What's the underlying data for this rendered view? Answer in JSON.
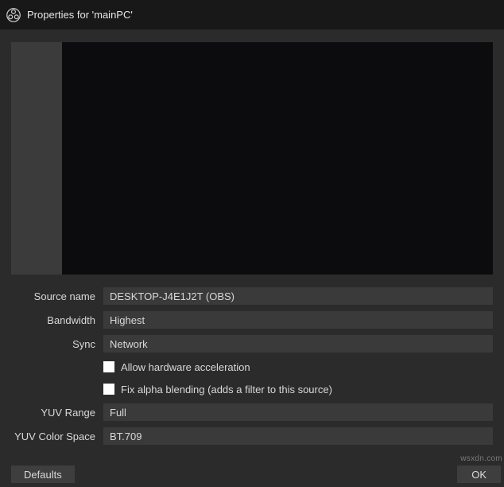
{
  "window": {
    "title": "Properties for 'mainPC'"
  },
  "form": {
    "source_name": {
      "label": "Source name",
      "value": "DESKTOP-J4E1J2T (OBS)"
    },
    "bandwidth": {
      "label": "Bandwidth",
      "value": "Highest"
    },
    "sync": {
      "label": "Sync",
      "value": "Network"
    },
    "hw_accel": {
      "label": "Allow hardware acceleration",
      "checked": false
    },
    "alpha_fix": {
      "label": "Fix alpha blending (adds a filter to this source)",
      "checked": false
    },
    "yuv_range": {
      "label": "YUV Range",
      "value": "Full"
    },
    "yuv_cs": {
      "label": "YUV Color Space",
      "value": "BT.709"
    }
  },
  "footer": {
    "defaults": "Defaults",
    "ok": "OK"
  },
  "watermark": "wsxdn.com"
}
